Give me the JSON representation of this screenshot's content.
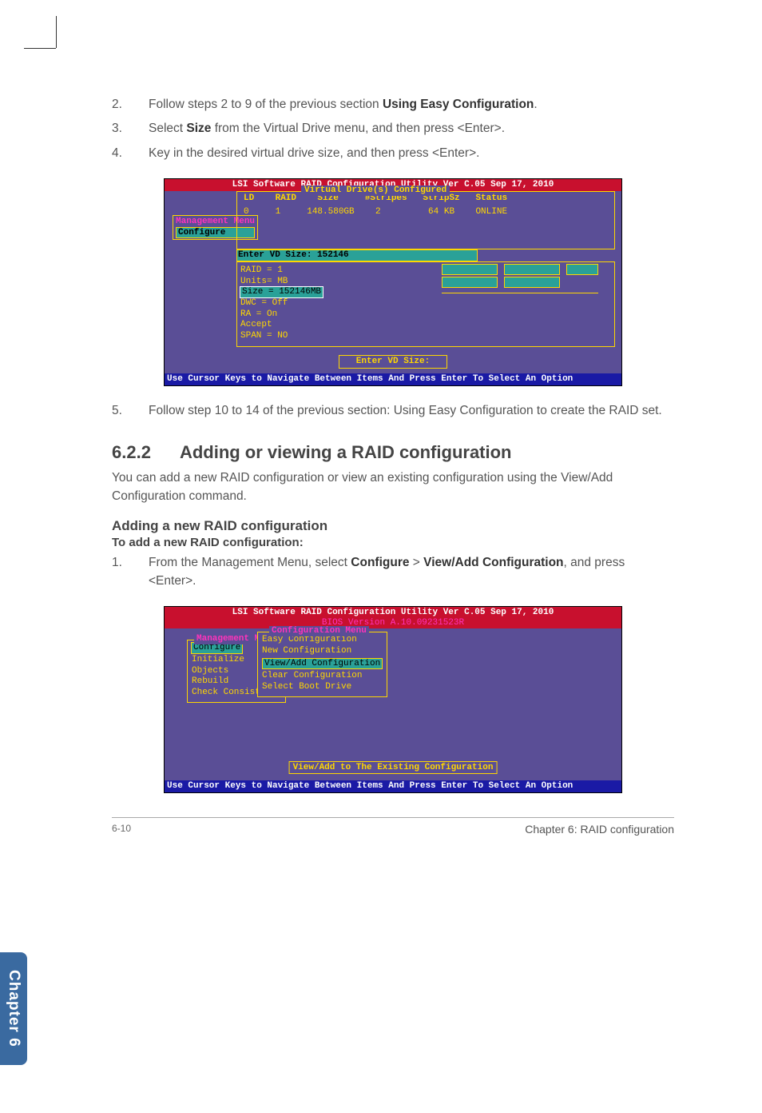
{
  "steps_top": [
    {
      "num": "2.",
      "before": "Follow steps 2 to 9 of the previous section ",
      "bold": "Using Easy Configuration",
      "after": "."
    },
    {
      "num": "3.",
      "before": "Select ",
      "bold": "Size",
      "after": " from the Virtual Drive menu, and then press <Enter>."
    },
    {
      "num": "4.",
      "before": "Key in the desired virtual drive size, and then press <Enter>.",
      "bold": "",
      "after": ""
    }
  ],
  "bios1": {
    "title": "LSI Software RAID Configuration Utility Ver C.05 Sep 17, 2010",
    "box_title": "Virtual Drive(s) Configured",
    "cols": "LD    RAID    Size     #Stripes   StripSz   Status",
    "row": "0     1     148.580GB    2         64 KB    ONLINE",
    "left_tag1": "Management Menu",
    "left_tag2": "Configure",
    "enter_label": "Enter VD Size: 152146",
    "pane": {
      "l1": "RAID = 1",
      "l2": "Units= MB",
      "l3": "Size = 152146MB",
      "l4": "DWC  = Off",
      "l5": "RA   = On",
      "l6": "Accept",
      "l7": "SPAN = NO"
    },
    "help": "Enter VD Size:",
    "footer": "Use Cursor Keys to Navigate Between Items And Press Enter To Select An Option"
  },
  "step5": {
    "num": "5.",
    "text": "Follow step 10 to 14 of the previous section: Using Easy Configuration to create the RAID set."
  },
  "section": {
    "num": "6.2.2",
    "title": "Adding or viewing a RAID configuration",
    "intro": "You can add a new RAID configuration or view an existing configuration using the View/Add Configuration command.",
    "sub": "Adding a new RAID configuration",
    "bold": "To add a new RAID configuration:"
  },
  "step1b": {
    "num": "1.",
    "before": "From the Management Menu, select ",
    "b1": "Configure",
    "mid": " > ",
    "b2": "View/Add Configuration",
    "after": ", and press <Enter>."
  },
  "bios2": {
    "title": "LSI Software RAID Configuration Utility Ver C.05 Sep 17, 2010",
    "bios_ver": "BIOS Version   A.10.09231523R",
    "mm_title": "Management Menu",
    "mm_items": [
      "Configure",
      "Initialize",
      "Objects",
      "Rebuild",
      "Check Consistency"
    ],
    "cfg_title": "Configuration Menu",
    "cfg_items": [
      "Easy Configuration",
      "New Configuration",
      "View/Add Configuration",
      "Clear Configuration",
      "Select Boot Drive"
    ],
    "help": "View/Add to The Existing Configuration",
    "footer": "Use Cursor Keys to Navigate Between Items And Press Enter To Select An Option"
  },
  "tab": "Chapter 6",
  "footer": {
    "page": "6-10",
    "chapter": "Chapter 6: RAID configuration"
  }
}
